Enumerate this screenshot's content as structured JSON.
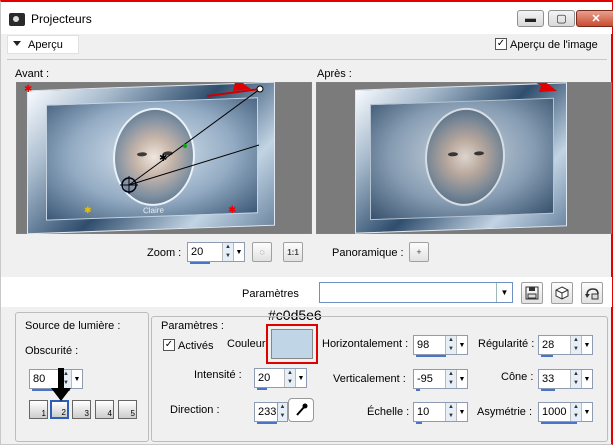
{
  "window": {
    "title": "Projecteurs",
    "controls": {
      "minimize": "▬",
      "maximize": "▢",
      "close": "✕"
    }
  },
  "preview_toggle": {
    "label": "Aperçu"
  },
  "image_preview": {
    "label": "Aperçu de l'image",
    "checked": true,
    "check_mark": "✓"
  },
  "previews": {
    "before_label": "Avant :",
    "after_label": "Après :",
    "watermark_in_image": "Claire"
  },
  "zoom": {
    "label": "Zoom :",
    "value": "20",
    "fit_icon": "◌",
    "one_to_one_label": "1:1"
  },
  "panoramique": {
    "label": "Panoramique :",
    "icon": "+"
  },
  "presets": {
    "label": "Paramètres",
    "value": "",
    "dropdown": "▼"
  },
  "annotation": {
    "hex": "#c0d5e6"
  },
  "light_source": {
    "group_label": "Source de lumière :",
    "obscurite_label": "Obscurité :",
    "obscurite_value": "80",
    "lights": [
      "1",
      "2",
      "3",
      "4",
      "5"
    ]
  },
  "params": {
    "group_label": "Paramètres :",
    "actives_label": "Activés",
    "actives_checked": true,
    "couleur_label": "Couleur",
    "color": "#c0d5e6",
    "intensite_label": "Intensité :",
    "intensite_value": "20",
    "direction_label": "Direction :",
    "direction_value": "233",
    "horizontalement_label": "Horizontalement :",
    "horizontalement_value": "98",
    "verticalement_label": "Verticalement :",
    "verticalement_value": "-95",
    "echelle_label": "Échelle :",
    "echelle_value": "10",
    "regularite_label": "Régularité :",
    "regularite_value": "28",
    "cone_label": "Cône :",
    "cone_value": "33",
    "asymetrie_label": "Asymétrie :",
    "asymetrie_value": "1000"
  },
  "colors": {
    "annotation_red": "#e00000",
    "accent_blue": "#4a74c5"
  }
}
